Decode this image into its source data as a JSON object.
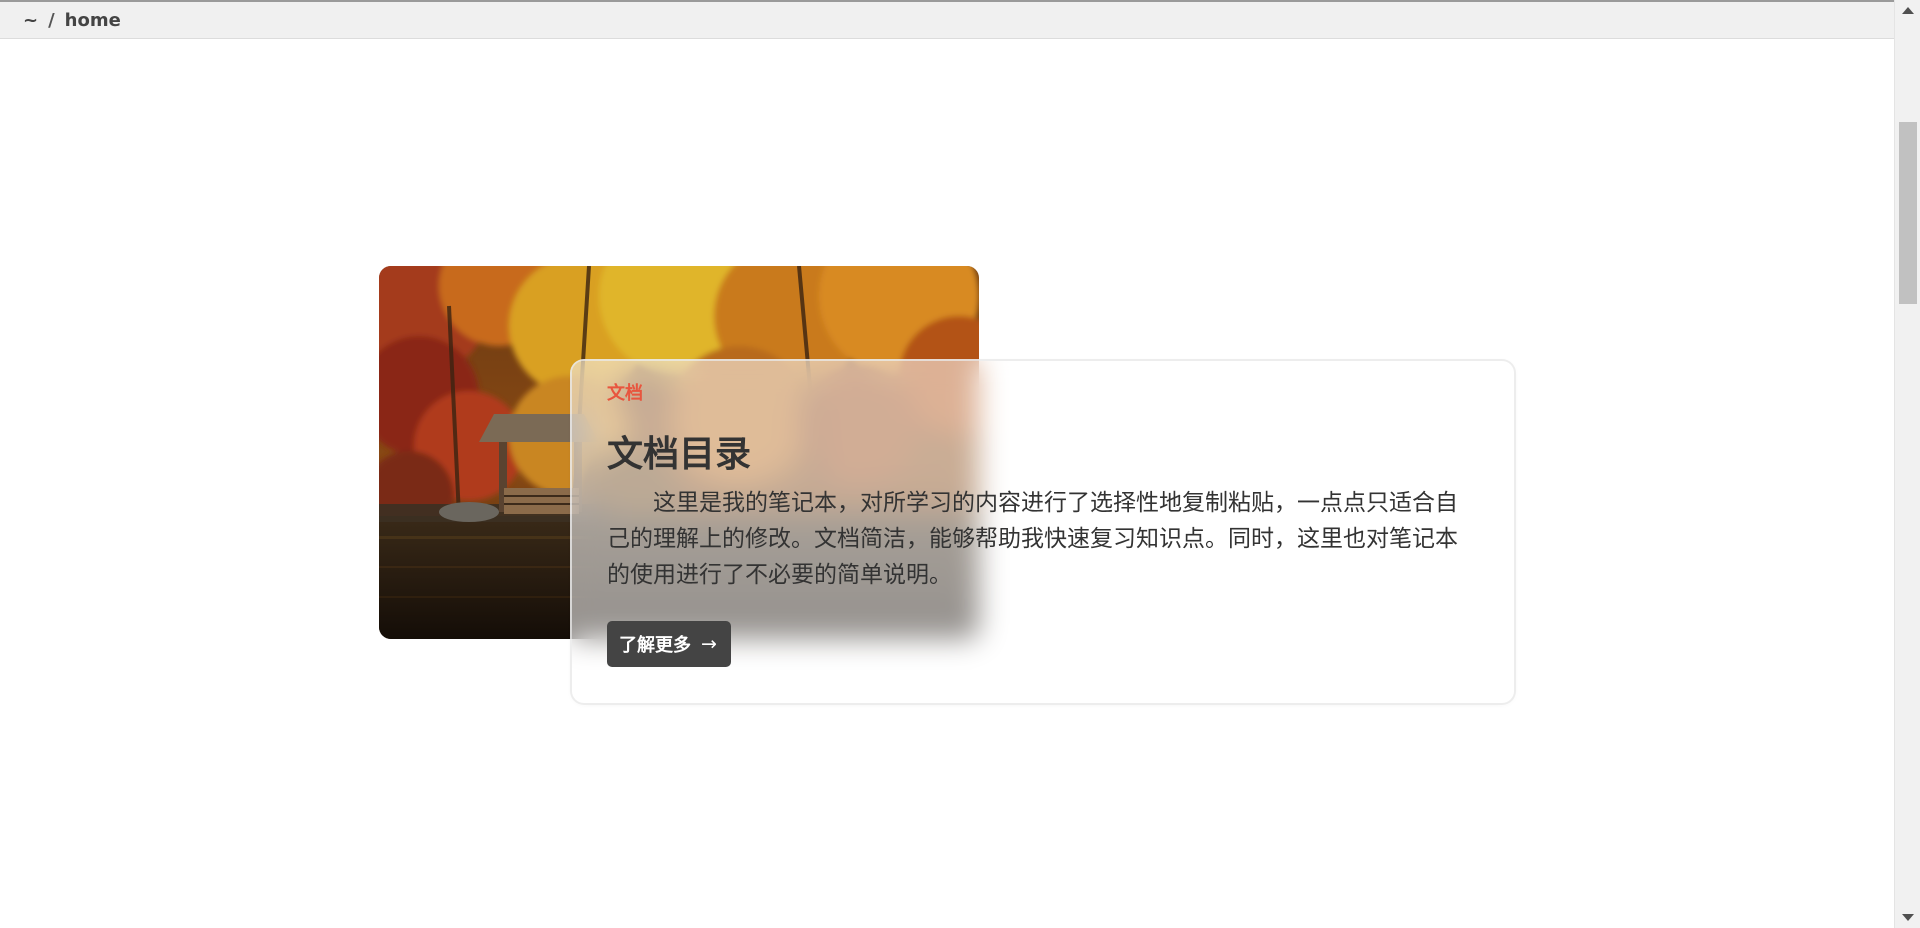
{
  "breadcrumb": {
    "root": "~",
    "separator": "/",
    "current": "home"
  },
  "card": {
    "tag": "文档",
    "title": "文档目录",
    "description": "这里是我的笔记本，对所学习的内容进行了选择性地复制粘贴，一点点只适合自己的理解上的修改。文档简洁，能够帮助我快速复习知识点。同时，这里也对笔记本的使用进行了不必要的简单说明。",
    "button_label": "了解更多",
    "button_icon": "→"
  },
  "colors": {
    "tag": "#e8553e",
    "button_bg": "#444444",
    "topbar_bg": "#f0f0f0"
  }
}
